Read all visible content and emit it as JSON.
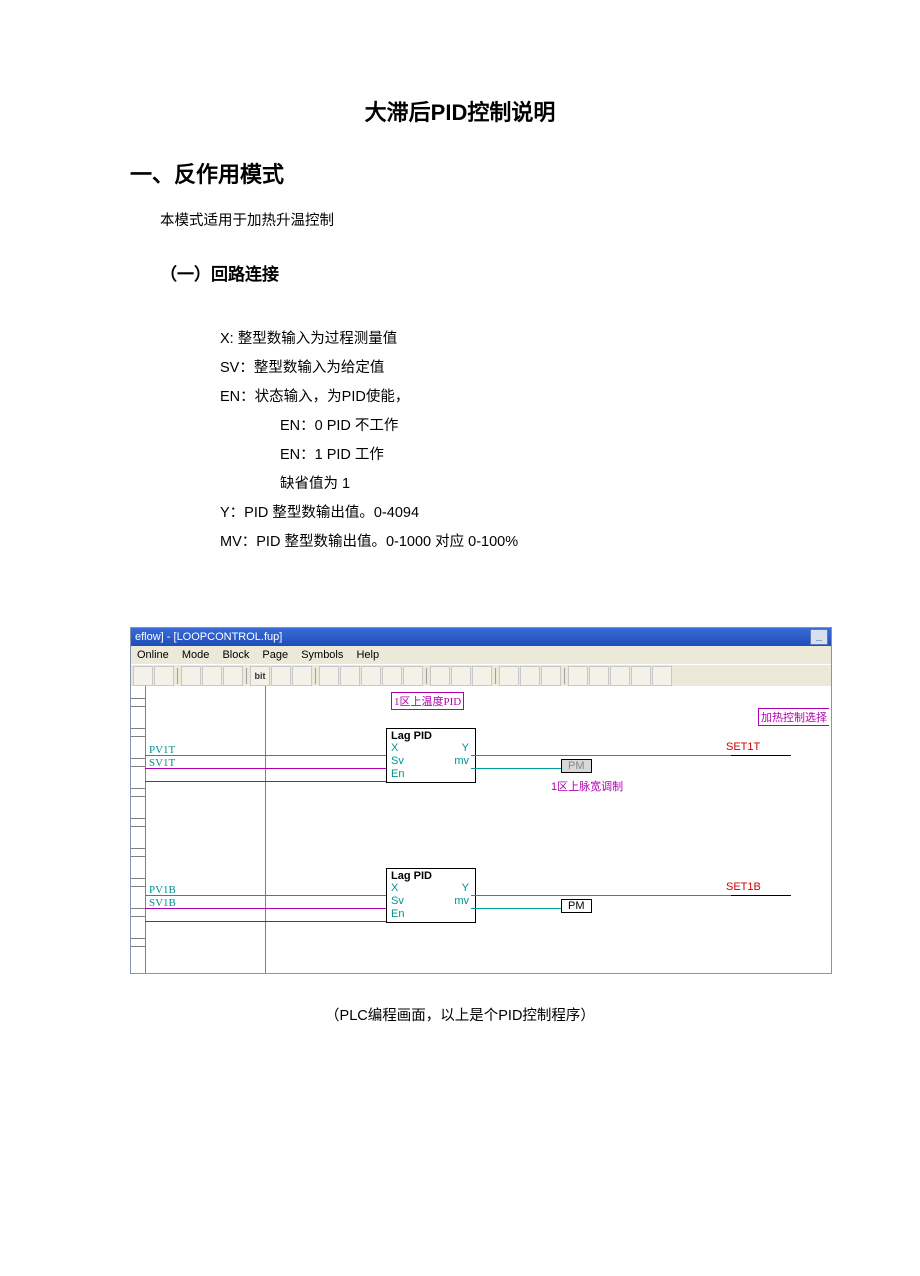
{
  "title": "大滞后PID控制说明",
  "section1": {
    "heading": "一、反作用模式",
    "intro": "本模式适用于加热升温控制",
    "sub1": {
      "heading": "（一）回路连接",
      "defs": {
        "x": "X: 整型数输入为过程测量值",
        "sv": "SV：整型数输入为给定值",
        "en": "EN：状态输入，为PID使能，",
        "en0": "EN：0    PID 不工作",
        "en1": "EN：1    PID 工作",
        "def": "缺省值为  1",
        "y": "Y：PID 整型数输出值。0-4094",
        "mv": "MV：PID 整型数输出值。0-1000 对应  0-100%"
      }
    }
  },
  "plc": {
    "titlebar": "eflow] - [LOOPCONTROL.fup]",
    "menus": {
      "online": "Online",
      "mode": "Mode",
      "block": "Block",
      "page": "Page",
      "symbols": "Symbols",
      "help": "Help"
    },
    "tags": {
      "top_title": "1区上温度PID",
      "heat_sel": "加热控制选择",
      "pulse": "1区上脉宽调制"
    },
    "inputs": {
      "pv1t": "PV1T",
      "sv1t": "SV1T",
      "pv1b": "PV1B",
      "sv1b": "SV1B"
    },
    "block": {
      "name": "Lag PID",
      "ports": {
        "x": "X",
        "sv": "Sv",
        "en": "En",
        "y": "Y",
        "mv": "mv"
      }
    },
    "pm": "PM",
    "outputs": {
      "set1t": "SET1T",
      "set1b": "SET1B"
    }
  },
  "caption": "（PLC编程画面，以上是个PID控制程序）"
}
